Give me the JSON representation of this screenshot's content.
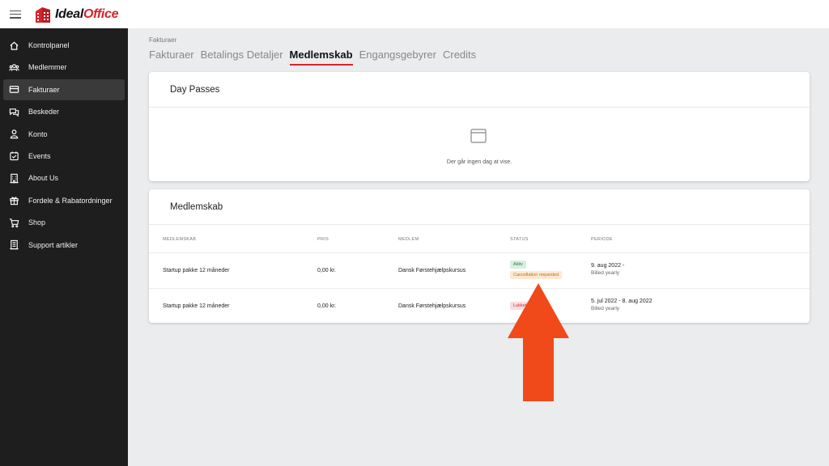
{
  "brand": {
    "part1": "Ideal",
    "part2": "Office",
    "color": "#d9232a"
  },
  "sidebar": {
    "items": [
      {
        "label": "Kontrolpanel",
        "icon": "home-icon"
      },
      {
        "label": "Medlemmer",
        "icon": "members-icon"
      },
      {
        "label": "Fakturaer",
        "icon": "credit-card-icon",
        "active": true
      },
      {
        "label": "Beskeder",
        "icon": "chat-icon"
      },
      {
        "label": "Konto",
        "icon": "user-icon"
      },
      {
        "label": "Events",
        "icon": "calendar-check-icon"
      },
      {
        "label": "About Us",
        "icon": "building-icon"
      },
      {
        "label": "Fordele & Rabatordninger",
        "icon": "gift-icon"
      },
      {
        "label": "Shop",
        "icon": "cart-icon"
      },
      {
        "label": "Support artikler",
        "icon": "document-icon"
      }
    ]
  },
  "breadcrumb": "Fakturaer",
  "tabs": [
    {
      "label": "Fakturaer"
    },
    {
      "label": "Betalings Detaljer"
    },
    {
      "label": "Medlemskab",
      "active": true
    },
    {
      "label": "Engangsgebyrer"
    },
    {
      "label": "Credits"
    }
  ],
  "day_passes": {
    "title": "Day Passes",
    "empty_text": "Der går ingen dag at vise."
  },
  "membership": {
    "title": "Medlemskab",
    "columns": [
      "MEDLEMSKAB",
      "PRIS",
      "MEDLEM",
      "STATUS",
      "PERIODE"
    ],
    "rows": [
      {
        "name": "Startup pakke 12 måneder",
        "price": "0,00 kr.",
        "member": "Dansk Førstehjælpskursus",
        "status": "Aktiv",
        "status2": "Cancellation requested",
        "period": "9. aug 2022 -",
        "billing": "Billed yearly"
      },
      {
        "name": "Startup pakke 12 måneder",
        "price": "0,00 kr.",
        "member": "Dansk Førstehjælpskursus",
        "status": "Lukket",
        "period": "5. jul 2022 - 8. aug 2022",
        "billing": "Billed yearly"
      }
    ]
  },
  "annotation": {
    "icon": "arrow-up-icon",
    "color": "#f04a1a"
  }
}
